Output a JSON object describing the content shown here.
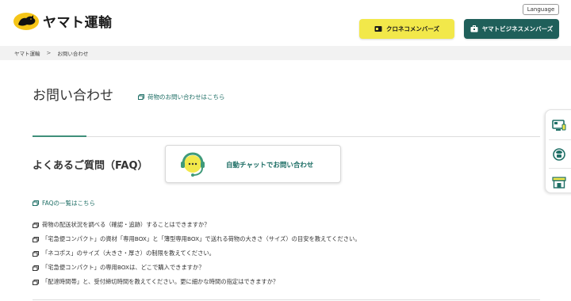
{
  "header": {
    "logo_text": "ヤマト運輸",
    "language_label": "Language",
    "kuroneko_members_label": "クロネコメンバーズ",
    "business_members_label": "ヤマトビジネスメンバーズ"
  },
  "breadcrumb": {
    "items": [
      "ヤマト運輸",
      "お問い合わせ"
    ],
    "separator": ">"
  },
  "main": {
    "title": "お問い合わせ",
    "cargo_inquiry_link": "荷物のお問い合わせはこちら"
  },
  "faq": {
    "heading": "よくあるご質問（FAQ）",
    "chat_button_label": "自動チャットでお問い合わせ",
    "list_link": "FAQの一覧はこちら",
    "questions": [
      "荷物の配送状況を調べる（確認・追跡）することはできますか？",
      "「宅急便コンパクト」の資材「専用BOX」と「薄型専用BOX」で送れる荷物の大きさ（サイズ）の目安を教えてください。",
      "「ネコポス」のサイズ（大きさ・厚さ）の制限を教えてください。",
      "「宅急便コンパクト」の専用BOXは、どこで購入できますか？",
      "「配達時間帯」と、受付締切時間を教えてください。更に細かな時間の指定はできますか？"
    ]
  },
  "side_tab": {
    "icons": [
      "computer-icon",
      "phone-icon",
      "store-icon"
    ]
  },
  "colors": {
    "accent_green": "#1f6f66",
    "yellow_button": "#f2e84a",
    "teal_button": "#1f5f5a"
  }
}
